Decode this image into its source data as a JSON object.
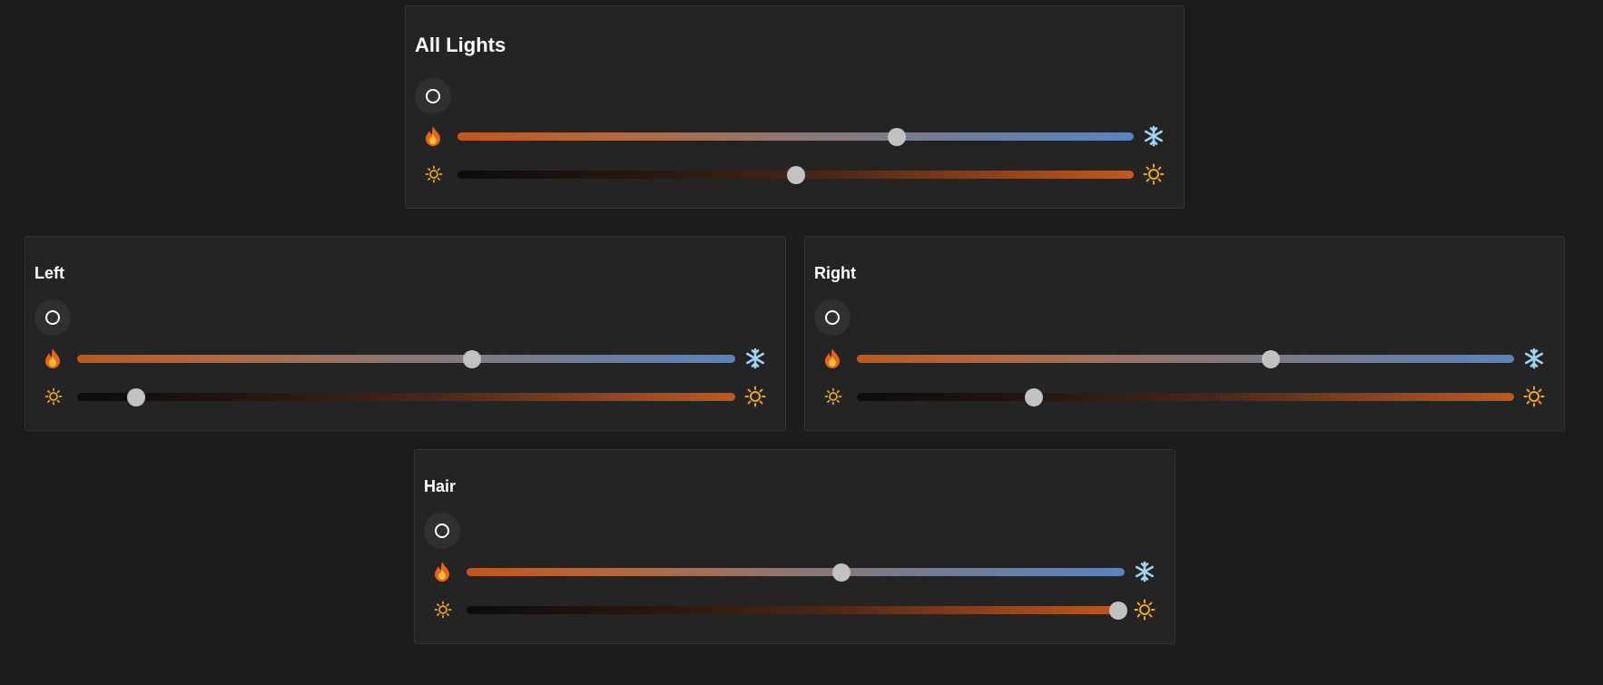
{
  "colors": {
    "background": "#1c1c1c",
    "panel": "#242424",
    "warm": "#c0571c",
    "cool": "#5a83c0",
    "thumb": "#c2c2c2"
  },
  "icons": {
    "power": "power-icon",
    "temperature_warm": "fire-icon",
    "temperature_cool": "snowflake-icon",
    "brightness_low": "sun-dim-icon",
    "brightness_high": "sun-bright-icon"
  },
  "panels": [
    {
      "title": "All Lights",
      "temperature": 0.65,
      "brightness": 0.5
    },
    {
      "title": "Left",
      "temperature": 0.6,
      "brightness": 0.09
    },
    {
      "title": "Right",
      "temperature": 0.63,
      "brightness": 0.27
    },
    {
      "title": "Hair",
      "temperature": 0.57,
      "brightness": 0.99
    }
  ]
}
